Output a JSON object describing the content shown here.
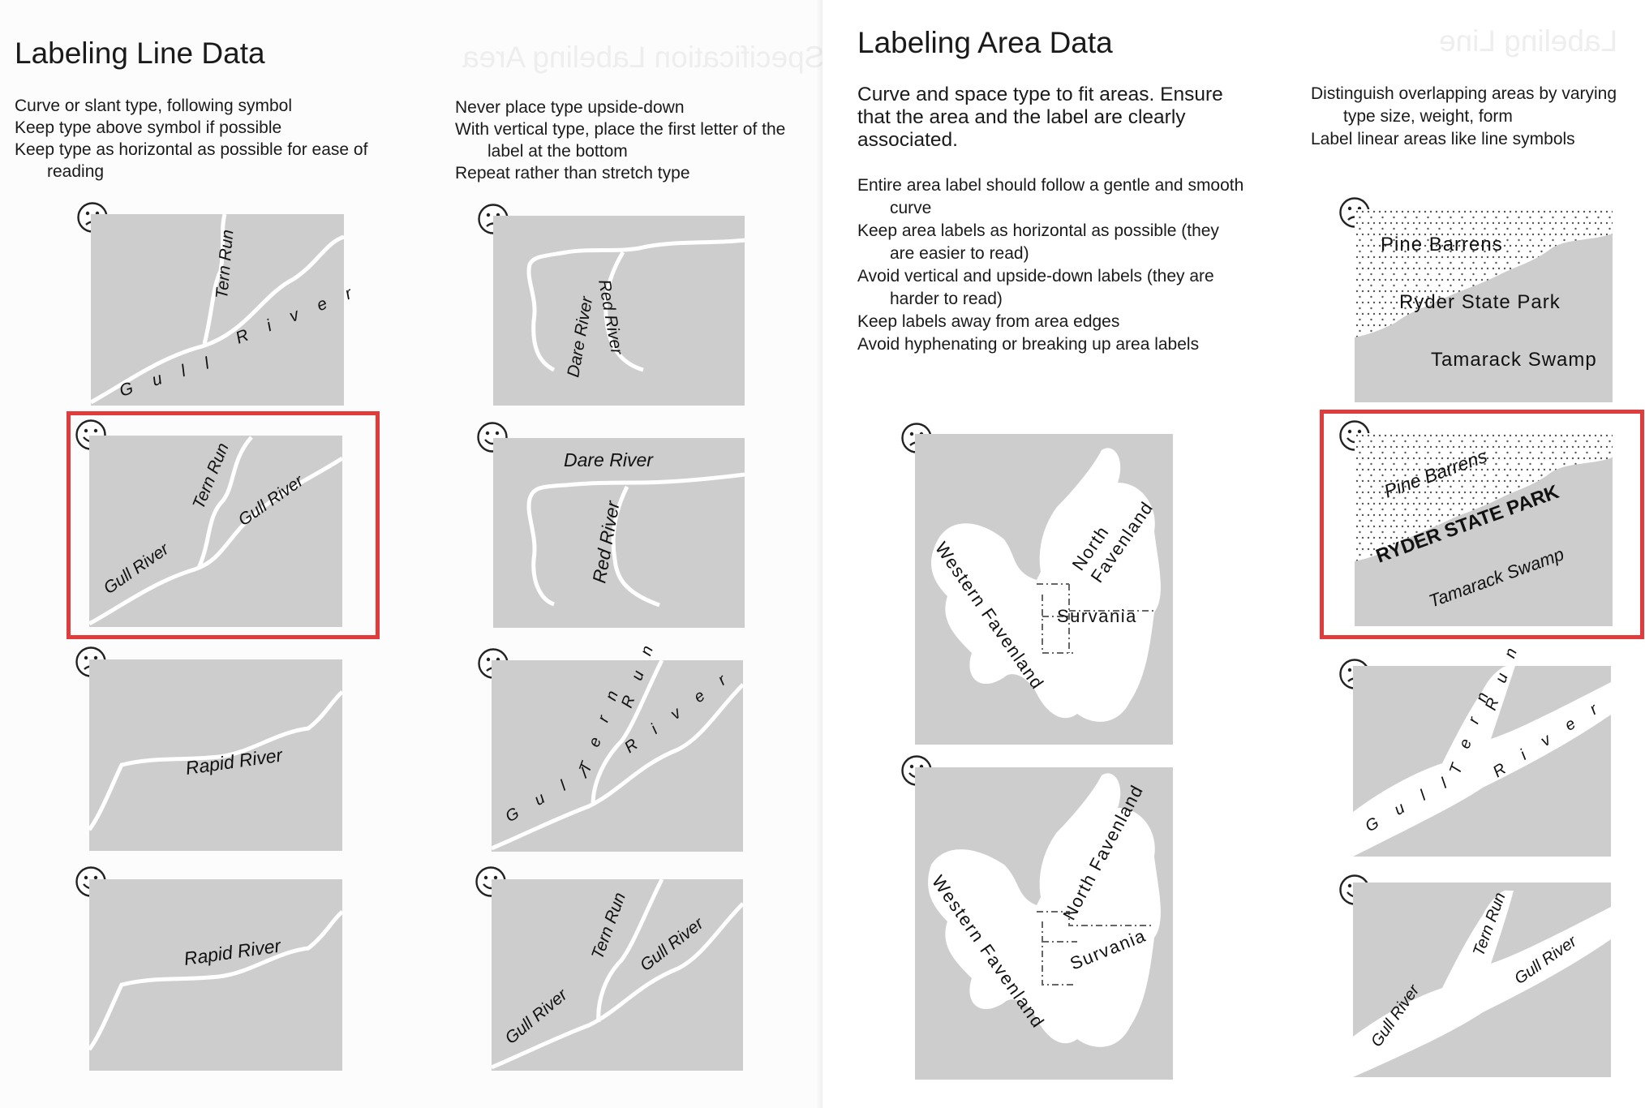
{
  "left_page": {
    "title": "Labeling Line Data",
    "col1": [
      "Curve or slant type, following symbol",
      "Keep type above symbol if possible",
      "Keep type as horizontal as possible for ease of reading"
    ],
    "col2": [
      "Never place type upside-down",
      "With vertical type, place the first letter of the label at the bottom",
      "Repeat rather than stretch type"
    ]
  },
  "right_page": {
    "title": "Labeling Area Data",
    "intro": "Curve and space type to fit areas. Ensure that the area and the label are clearly associated.",
    "col1": [
      "Entire area label should follow a gentle and smooth curve",
      "Keep area labels as horizontal as possible (they are easier to read)",
      "Avoid vertical and upside-down labels (they are harder to read)",
      "Keep labels away from area edges",
      "Avoid hyphenating or breaking up area labels"
    ],
    "col2": [
      "Distinguish overlapping areas by varying type size, weight, form",
      "Label linear areas like line symbols"
    ]
  },
  "labels": {
    "tern_run": "Tern Run",
    "gull_river": "Gull River",
    "dare_river": "Dare River",
    "red_river": "Red River",
    "rapid_river": "Rapid River",
    "western_favenland": "Western Favenland",
    "north_favenland": "North Favenland",
    "north": "North",
    "favenland": "Favenland",
    "survania": "Survania",
    "pine_barrens": "Pine Barrens",
    "ryder_state_park": "Ryder State Park",
    "ryder_state_park_caps": "RYDER STATE PARK",
    "tamarack_swamp": "Tamarack Swamp",
    "gull_spaced": "G u l l",
    "river_spaced": "R i v e r",
    "tern_spaced": "T e r n",
    "run_spaced": "R u n"
  },
  "ghost_text": {
    "left": "Line Specification Labeling Area",
    "right": "Labeling Line"
  },
  "colors": {
    "panel_gray": "#cdcdcd",
    "river_white": "#ffffff",
    "highlight_red": "#e23b3b",
    "text": "#1a1a1a"
  }
}
